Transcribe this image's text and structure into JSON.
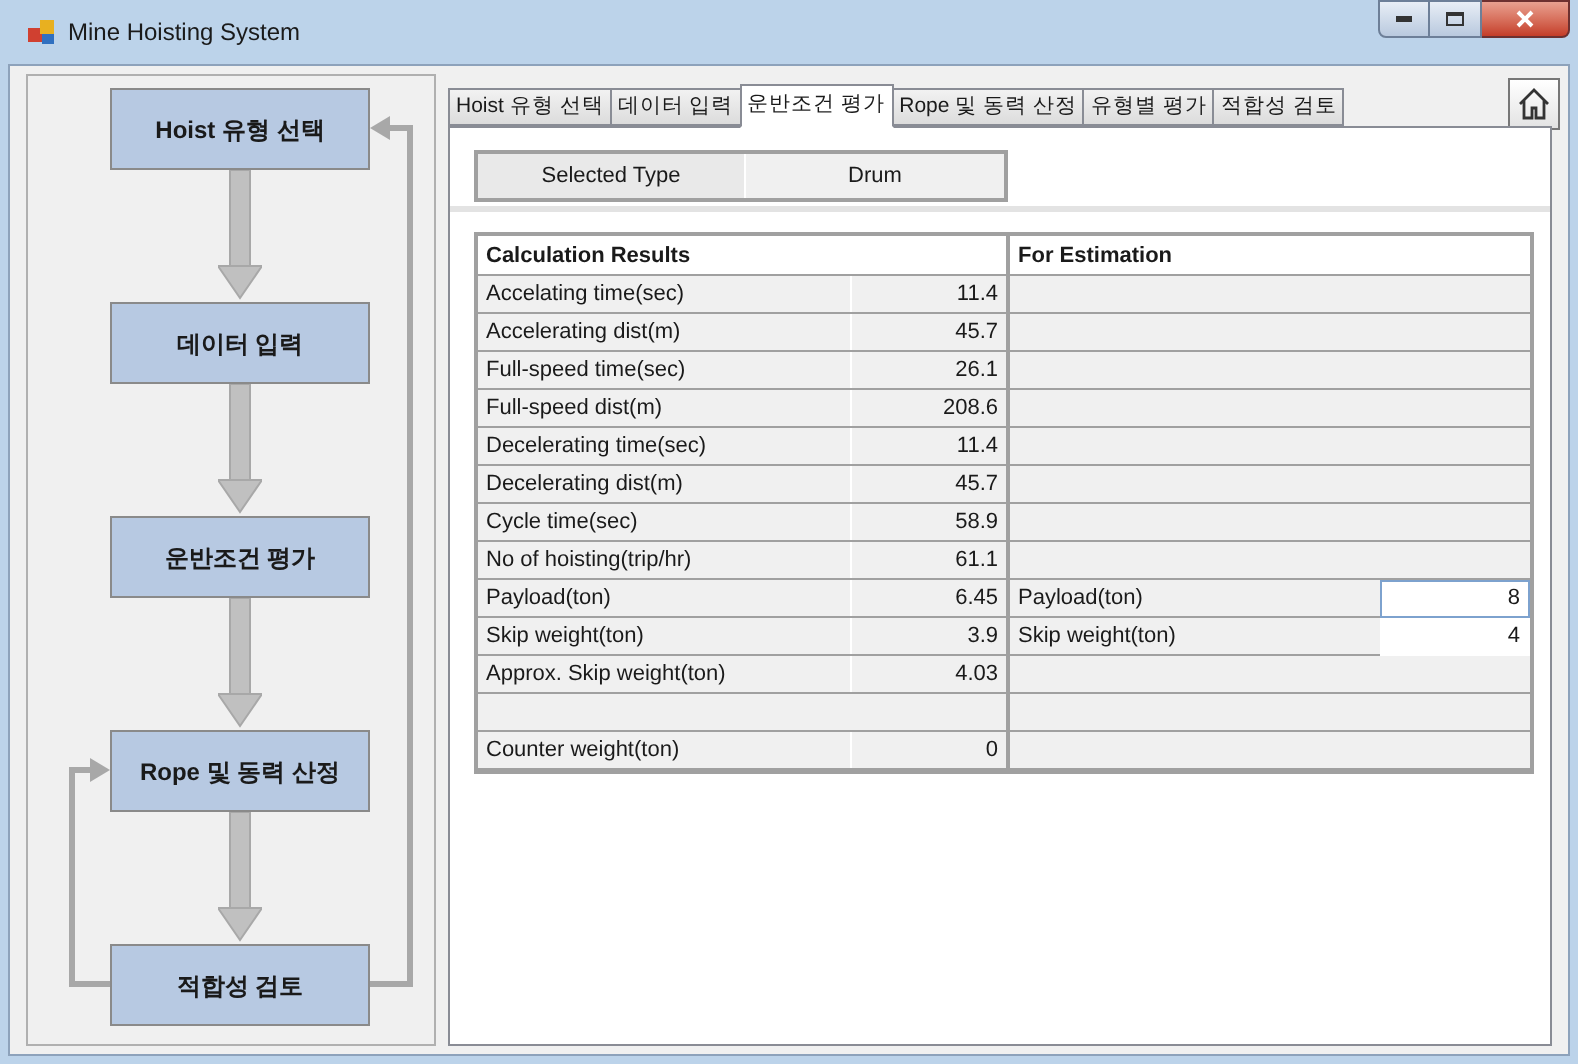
{
  "window": {
    "title": "Mine Hoisting System"
  },
  "flow_steps": [
    {
      "label": "Hoist 유형 선택"
    },
    {
      "label": "데이터 입력"
    },
    {
      "label": "운반조건 평가"
    },
    {
      "label": "Rope 및 동력 산정"
    },
    {
      "label": "적합성 검토"
    }
  ],
  "tabs": [
    {
      "label": "Hoist 유형 선택",
      "selected": false
    },
    {
      "label": "데이터 입력",
      "selected": false
    },
    {
      "label": "운반조건 평가",
      "selected": true
    },
    {
      "label": "Rope 및 동력 산정",
      "selected": false
    },
    {
      "label": "유형별 평가",
      "selected": false
    },
    {
      "label": "적합성 검토",
      "selected": false
    }
  ],
  "selected_type": {
    "label": "Selected Type",
    "value": "Drum"
  },
  "calculation_results": {
    "title": "Calculation Results",
    "rows": [
      {
        "kind": "value",
        "label": "Accelating time(sec)",
        "value": "11.4"
      },
      {
        "kind": "value",
        "label": "Accelerating dist(m)",
        "value": "45.7"
      },
      {
        "kind": "value",
        "label": "Full-speed time(sec)",
        "value": "26.1"
      },
      {
        "kind": "value",
        "label": "Full-speed dist(m)",
        "value": "208.6"
      },
      {
        "kind": "value",
        "label": "Decelerating time(sec)",
        "value": "11.4"
      },
      {
        "kind": "value",
        "label": "Decelerating dist(m)",
        "value": "45.7"
      },
      {
        "kind": "value",
        "label": "Cycle time(sec)",
        "value": "58.9"
      },
      {
        "kind": "value",
        "label": "No of hoisting(trip/hr)",
        "value": "61.1"
      },
      {
        "kind": "value",
        "label": "Payload(ton)",
        "value": "6.45"
      },
      {
        "kind": "value",
        "label": "Skip weight(ton)",
        "value": "3.9"
      },
      {
        "kind": "value",
        "label": "Approx. Skip weight(ton)",
        "value": "4.03"
      },
      {
        "kind": "blank"
      },
      {
        "kind": "value",
        "label": "Counter weight(ton)",
        "value": "0"
      }
    ]
  },
  "for_estimation": {
    "title": "For Estimation",
    "rows": [
      {
        "kind": "blank"
      },
      {
        "kind": "blank"
      },
      {
        "kind": "blank"
      },
      {
        "kind": "blank"
      },
      {
        "kind": "blank"
      },
      {
        "kind": "blank"
      },
      {
        "kind": "blank"
      },
      {
        "kind": "blank"
      },
      {
        "kind": "input",
        "label": "Payload(ton)",
        "value": "8",
        "focused": true
      },
      {
        "kind": "input",
        "label": "Skip weight(ton)",
        "value": "4",
        "focused": false
      },
      {
        "kind": "blank"
      },
      {
        "kind": "blank"
      },
      {
        "kind": "blank"
      }
    ]
  }
}
